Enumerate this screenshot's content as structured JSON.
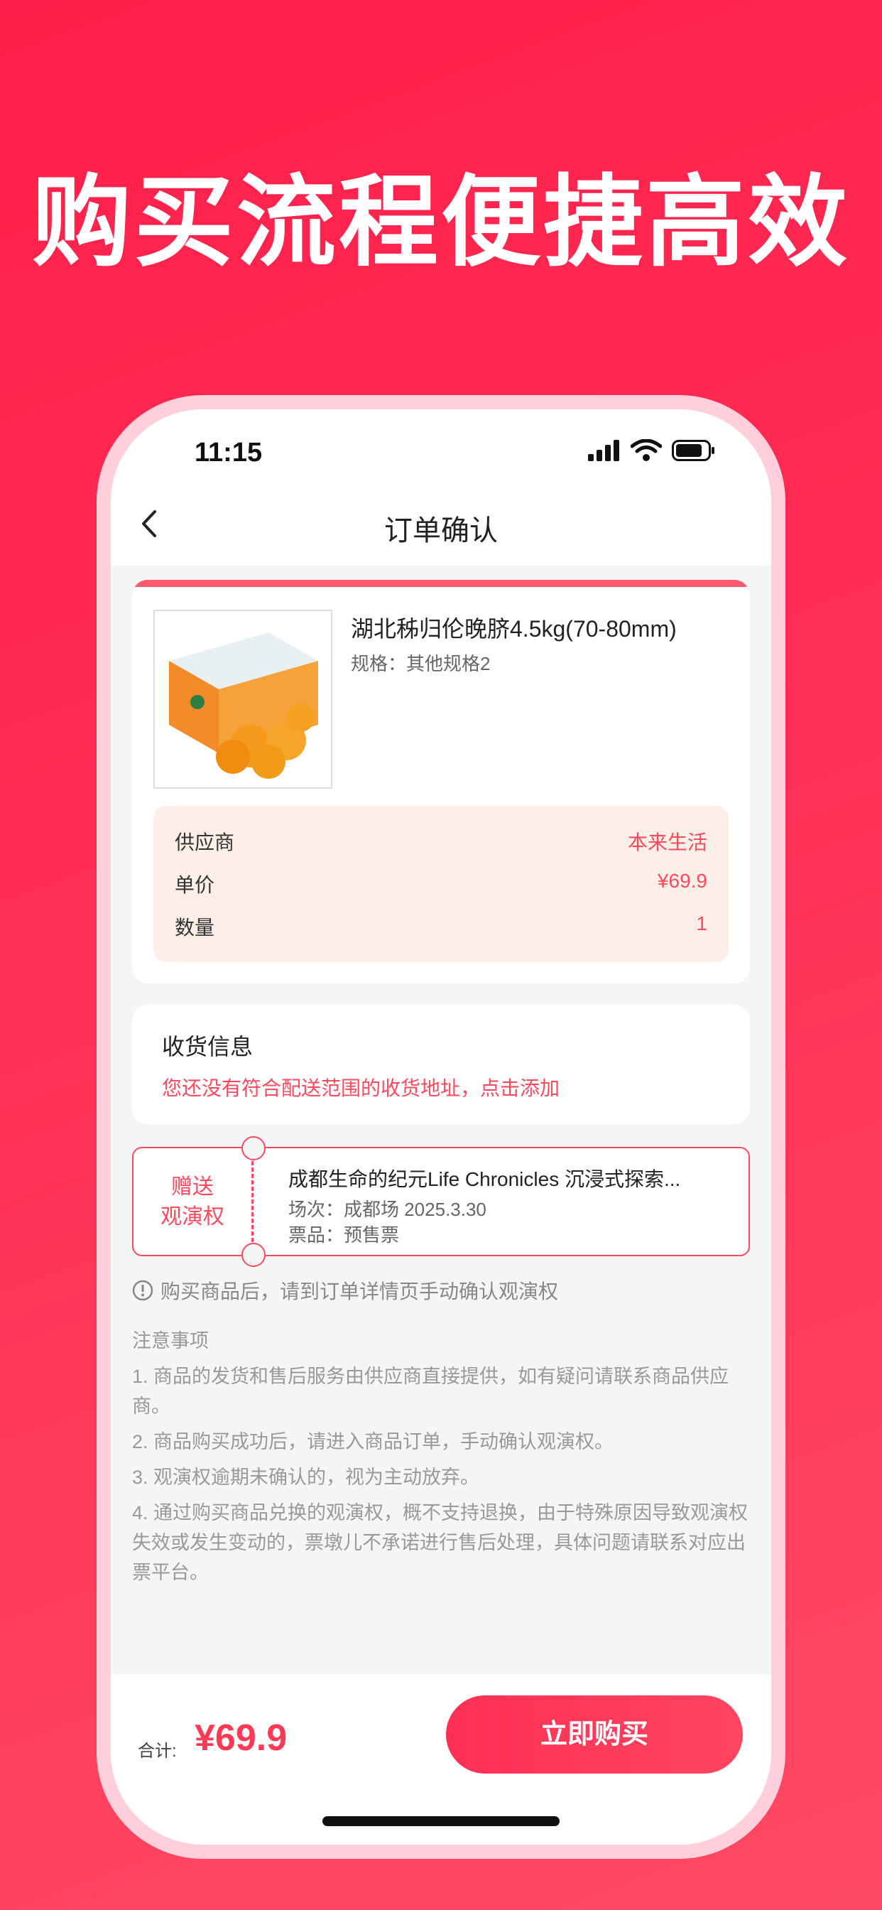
{
  "headline": "购买流程便捷高效",
  "status": {
    "time": "11:15"
  },
  "nav": {
    "title": "订单确认"
  },
  "product": {
    "name": "湖北秭归伦晚脐4.5kg(70-80mm)",
    "spec": "规格：其他规格2",
    "image_alt": "orange-gift-box"
  },
  "order_info": [
    {
      "label": "供应商",
      "value": "本来生活"
    },
    {
      "label": "单价",
      "value": "¥69.9"
    },
    {
      "label": "数量",
      "value": "1"
    }
  ],
  "address": {
    "title": "收货信息",
    "link": "您还没有符合配送范围的收货地址，点击添加"
  },
  "ticket": {
    "badge_line1": "赠送",
    "badge_line2": "观演权",
    "title": "成都生命的纪元Life Chronicles 沉浸式探索...",
    "session": "场次：成都场 2025.3.30",
    "ticket_type": "票品：预售票"
  },
  "tip": "购买商品后，请到订单详情页手动确认观演权",
  "notes": {
    "title": "注意事项",
    "items": [
      "1. 商品的发货和售后服务由供应商直接提供，如有疑问请联系商品供应商。",
      "2. 商品购买成功后，请进入商品订单，手动确认观演权。",
      "3. 观演权逾期未确认的，视为主动放弃。",
      "4. 通过购买商品兑换的观演权，概不支持退换，由于特殊原因导致观演权失效或发生变动的，票墩儿不承诺进行售后处理，具体问题请联系对应出票平台。"
    ]
  },
  "footer": {
    "total_label": "合计:",
    "total_price": "¥69.9",
    "buy_label": "立即购买"
  },
  "colors": {
    "brand": "#ff2f55",
    "accent": "#ff4a5e",
    "supplier_bg": "#fdeee7"
  }
}
